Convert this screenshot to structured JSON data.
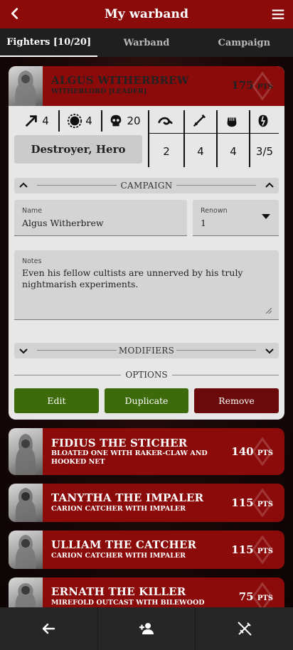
{
  "appbar": {
    "title": "My warband",
    "back_icon": "arrow-back-icon",
    "menu_icon": "hamburger-menu-icon"
  },
  "tabs": [
    {
      "label": "Fighters [10/20]",
      "active": true
    },
    {
      "label": "Warband",
      "active": false
    },
    {
      "label": "Campaign",
      "active": false
    }
  ],
  "expanded_fighter": {
    "name": "Algus Witherbrew",
    "subtitle": "Witherlord [Leader]",
    "points": "175",
    "points_unit": "PTS",
    "stats_top": [
      {
        "icon": "movement-arrow-icon",
        "value": "4"
      },
      {
        "icon": "toughness-shield-icon",
        "value": "4"
      },
      {
        "icon": "wounds-skull-icon",
        "value": "20"
      }
    ],
    "weapon_icons": [
      "range-icon",
      "attacks-sword-icon",
      "strength-fist-icon",
      "damage-icon"
    ],
    "weapon_values": [
      "2",
      "4",
      "4",
      "3/5"
    ],
    "runemarks": "Destroyer, Hero",
    "campaign_section": "CAMPAIGN",
    "name_field": {
      "label": "Name",
      "value": "Algus Witherbrew"
    },
    "renown_field": {
      "label": "Renown",
      "value": "1"
    },
    "notes_field": {
      "label": "Notes",
      "value": "Even his fellow cultists are unnerved by his truly nightmarish experiments."
    },
    "modifiers_section": "MODIFIERS",
    "options_label": "OPTIONS",
    "buttons": {
      "edit": "Edit",
      "duplicate": "Duplicate",
      "remove": "Remove"
    },
    "button_colors": {
      "edit": "#3d6b0c",
      "duplicate": "#3d6b0c",
      "remove": "#6b0a0a"
    }
  },
  "fighters": [
    {
      "name": "Fidius the Sticher",
      "subtitle": "Bloated one with raker-claw and hooked net",
      "points": "140",
      "points_unit": "PTS"
    },
    {
      "name": "Tanytha the Impaler",
      "subtitle": "Carion Catcher with Impaler",
      "points": "115",
      "points_unit": "PTS"
    },
    {
      "name": "Ulliam the Catcher",
      "subtitle": "Carion catcher with impaler",
      "points": "115",
      "points_unit": "PTS"
    },
    {
      "name": "Ernath the Killer",
      "subtitle": "Mirefold outcast with bilewood",
      "points": "75",
      "points_unit": "PTS"
    }
  ],
  "bottom_nav": [
    {
      "icon": "arrow-back-icon"
    },
    {
      "icon": "add-person-icon"
    },
    {
      "icon": "crossed-swords-off-icon"
    }
  ],
  "colors": {
    "accent_red": "#8b0a0a",
    "green": "#3d6b0c",
    "dark_red": "#6b0a0a"
  }
}
